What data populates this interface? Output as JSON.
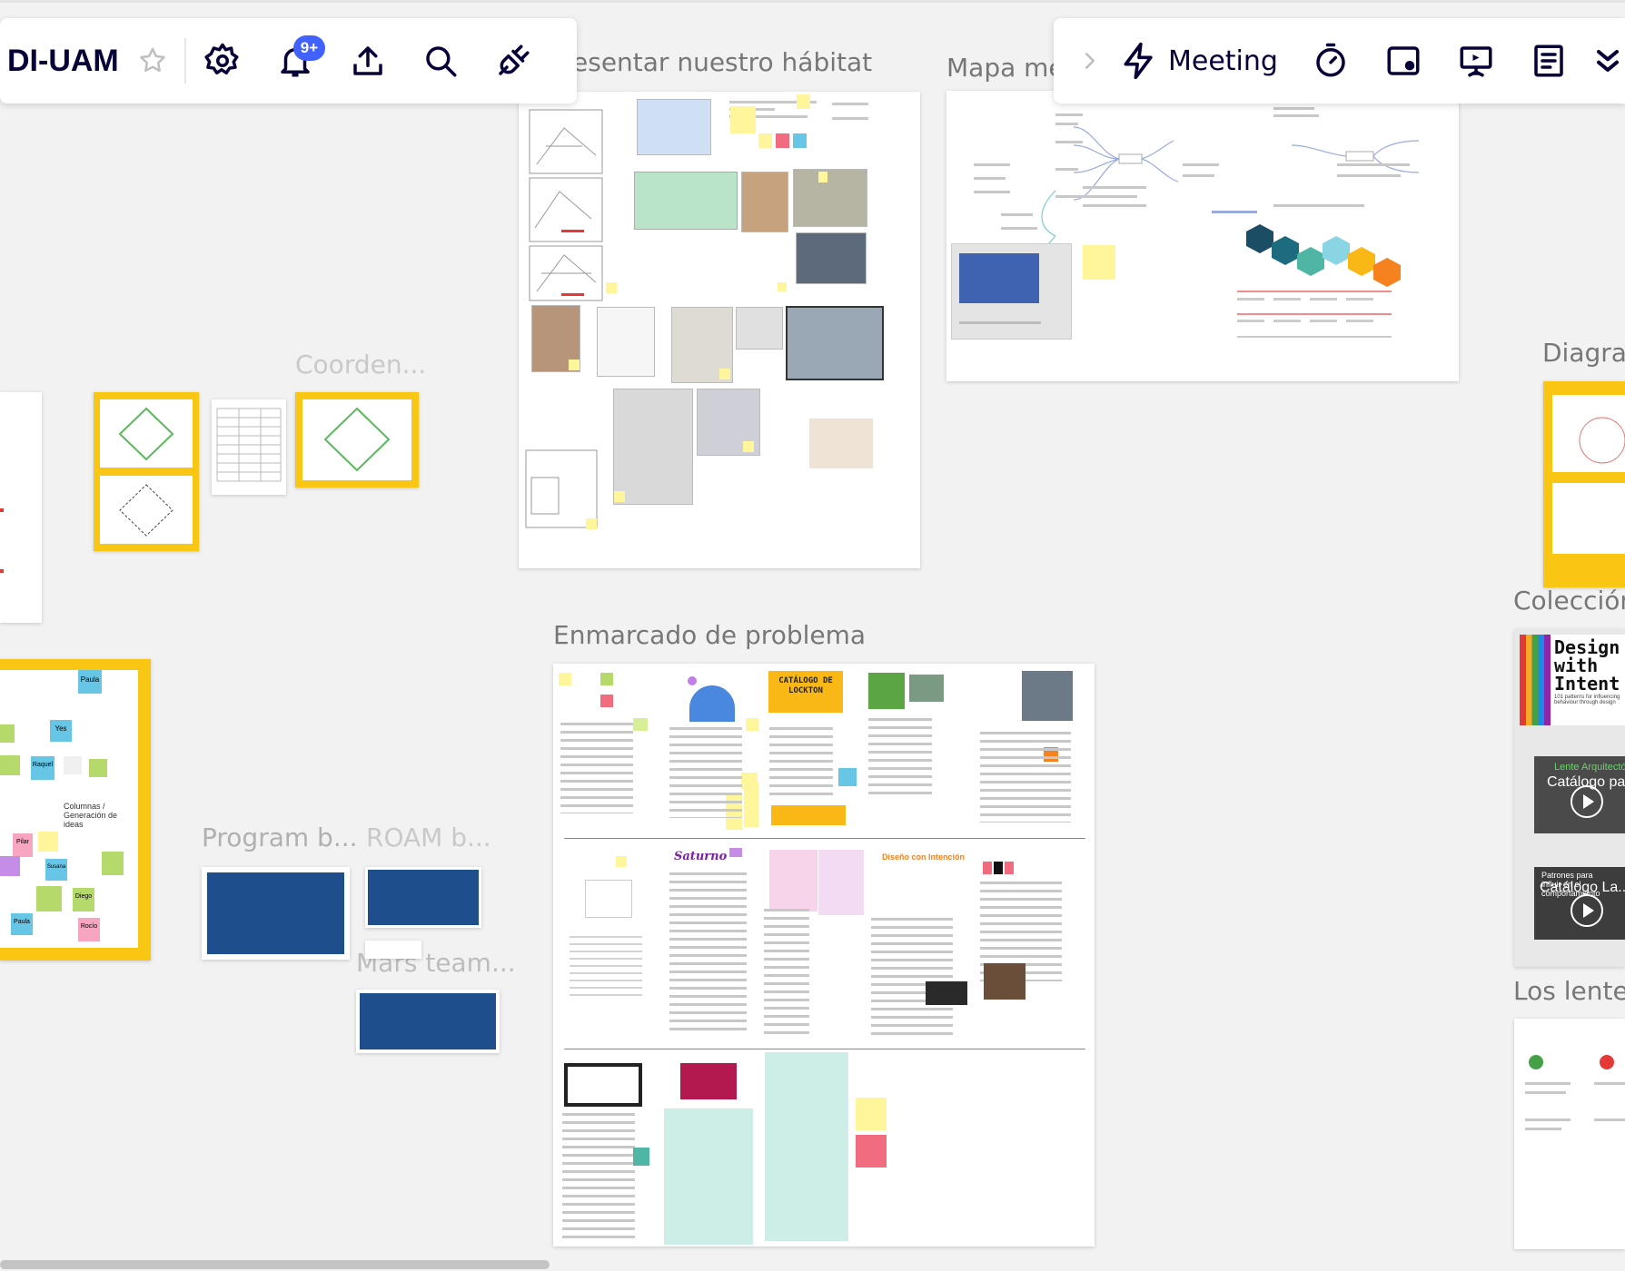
{
  "board": {
    "name": "DI-UAM",
    "notifications_badge": "9+"
  },
  "right_toolbar": {
    "meeting_label": "Meeting"
  },
  "frames": {
    "habitat": "esentar nuestro hábitat",
    "mapa": "Mapa me",
    "diagrama": "Diagrar",
    "coleccion": "Colección",
    "lentes": "Los lentes",
    "coorden": "Coorden...",
    "enmarcado": "Enmarcado de problema",
    "program": "Program b...",
    "roam": "ROAM b...",
    "mars": "Mars team..."
  },
  "sticky_names": [
    "Paula",
    "Yes",
    "Raquel",
    "Columnas / Generación de ideas",
    "Pilar",
    "Diego",
    "Paula",
    "Rocío",
    "Susana"
  ],
  "book": {
    "title_line1": "Design",
    "title_line2": "with",
    "title_line3": "Intent",
    "sub": "101 patterns for influencing behaviour through design",
    "lens1": "Lente Arquitectó",
    "lens1_overlay": "Catálogo pa...",
    "lens2": "Patrones para influir en el comportamiento",
    "lens2_overlay": "Catálogo La..."
  },
  "enmarcado_items": {
    "catalogo_l1": "CATÁLOGO DE",
    "catalogo_l2": "LOCKTON",
    "saturno": "Saturno",
    "disenio": "Diseño con Intención"
  },
  "colors": {
    "accent": "#4262ff",
    "frame_yellow": "#f9c713",
    "sticky_yellow": "#fff59b",
    "sticky_pink": "#f16c7f",
    "sticky_cyan": "#67c6e6"
  }
}
